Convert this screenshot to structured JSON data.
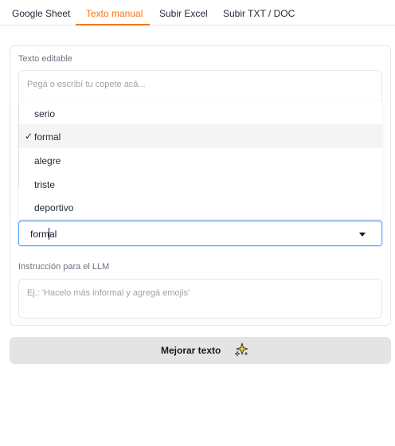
{
  "tabs": [
    {
      "label": "Google Sheet"
    },
    {
      "label": "Texto manual",
      "active": true
    },
    {
      "label": "Subir Excel"
    },
    {
      "label": "Subir TXT / DOC"
    }
  ],
  "editor": {
    "label": "Texto editable",
    "placeholder": "Pegá o escribí tu copete acá..."
  },
  "tone": {
    "options": [
      {
        "label": "serio"
      },
      {
        "label": "formal",
        "selected": true
      },
      {
        "label": "alegre"
      },
      {
        "label": "triste"
      },
      {
        "label": "deportivo"
      }
    ],
    "check_glyph": "✓",
    "value": "formal"
  },
  "instruction": {
    "label": "Instrucción para el LLM",
    "placeholder": "Ej.: 'Hacelo más informal y agregá emojis'"
  },
  "action": {
    "label": "Mejorar texto",
    "icon": "sparkles-icon"
  },
  "colors": {
    "accent": "#f97316",
    "focus": "#60a5fa",
    "button_bg": "#e4e4e7"
  }
}
